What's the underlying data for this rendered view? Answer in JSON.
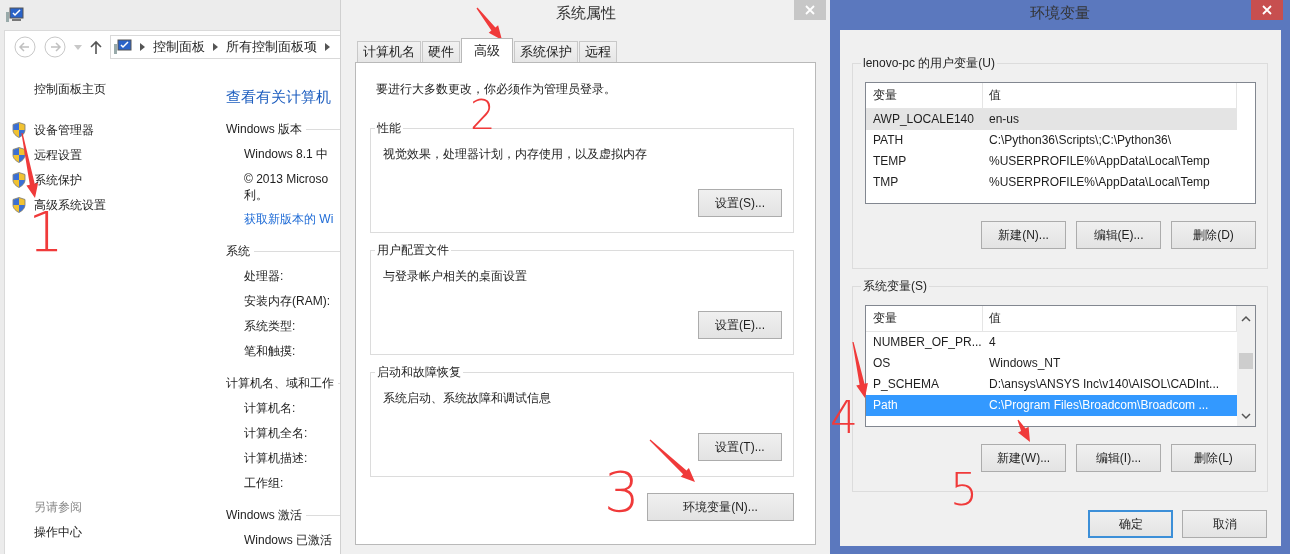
{
  "explorer": {
    "address": [
      "控制面板",
      "所有控制面板项"
    ],
    "nav_home": "控制面板主页",
    "nav_items": [
      "设备管理器",
      "远程设置",
      "系统保护",
      "高级系统设置"
    ],
    "see_also": "另请参阅",
    "see_also_items": [
      "操作中心"
    ],
    "heading": "查看有关计算机",
    "sections": [
      {
        "title": "Windows 版本",
        "items": [
          {
            "kind": "text",
            "text": "Windows 8.1 中"
          },
          {
            "kind": "paragraph",
            "text": "© 2013 Microso\n利。"
          },
          {
            "kind": "link",
            "text": "获取新版本的 Wi"
          }
        ]
      },
      {
        "title": "系统",
        "items": [
          {
            "kind": "text",
            "text": "处理器:"
          },
          {
            "kind": "text",
            "text": "安装内存(RAM):"
          },
          {
            "kind": "text",
            "text": "系统类型:"
          },
          {
            "kind": "text",
            "text": "笔和触摸:"
          }
        ]
      },
      {
        "title": "计算机名、域和工作",
        "items": [
          {
            "kind": "text",
            "text": "计算机名:"
          },
          {
            "kind": "text",
            "text": "计算机全名:"
          },
          {
            "kind": "text",
            "text": "计算机描述:"
          },
          {
            "kind": "text",
            "text": "工作组:"
          }
        ]
      },
      {
        "title": "Windows 激活",
        "items": [
          {
            "kind": "text",
            "text": "Windows 已激活"
          }
        ]
      }
    ]
  },
  "system_properties": {
    "title": "系统属性",
    "tabs": [
      {
        "label": "计算机名",
        "selected": false
      },
      {
        "label": "硬件",
        "selected": false
      },
      {
        "label": "高级",
        "selected": true
      },
      {
        "label": "系统保护",
        "selected": false
      },
      {
        "label": "远程",
        "selected": false
      }
    ],
    "notice": "要进行大多数更改，你必须作为管理员登录。",
    "groups": [
      {
        "title": "性能",
        "description": "视觉效果，处理器计划，内存使用，以及虚拟内存",
        "button": "设置(S)..."
      },
      {
        "title": "用户配置文件",
        "description": "与登录帐户相关的桌面设置",
        "button": "设置(E)..."
      },
      {
        "title": "启动和故障恢复",
        "description": "系统启动、系统故障和调试信息",
        "button": "设置(T)..."
      }
    ],
    "env_button": "环境变量(N)..."
  },
  "env_vars": {
    "title": "环境变量",
    "user_group": {
      "title": "lenovo-pc 的用户变量(U)",
      "focused": false,
      "columns": [
        "变量",
        "值"
      ],
      "rows": [
        {
          "name": "AWP_LOCALE140",
          "value": "en-us",
          "selected": true
        },
        {
          "name": "PATH",
          "value": "C:\\Python36\\Scripts\\;C:\\Python36\\",
          "selected": false
        },
        {
          "name": "TEMP",
          "value": "%USERPROFILE%\\AppData\\Local\\Temp",
          "selected": false
        },
        {
          "name": "TMP",
          "value": "%USERPROFILE%\\AppData\\Local\\Temp",
          "selected": false
        }
      ],
      "buttons": [
        "新建(N)...",
        "编辑(E)...",
        "删除(D)"
      ]
    },
    "system_group": {
      "title": "系统变量(S)",
      "focused": true,
      "columns": [
        "变量",
        "值"
      ],
      "rows": [
        {
          "name": "NUMBER_OF_PR...",
          "value": "4",
          "selected": false
        },
        {
          "name": "OS",
          "value": "Windows_NT",
          "selected": false
        },
        {
          "name": "P_SCHEMA",
          "value": "D:\\ansys\\ANSYS Inc\\v140\\AISOL\\CADInt...",
          "selected": false
        },
        {
          "name": "Path",
          "value": "C:\\Program Files\\Broadcom\\Broadcom ...",
          "selected": true
        }
      ],
      "buttons": [
        "新建(W)...",
        "编辑(I)...",
        "删除(L)"
      ]
    },
    "ok": "确定",
    "cancel": "取消"
  },
  "annotations": [
    {
      "label": "1"
    },
    {
      "label": "2"
    },
    {
      "label": "3"
    },
    {
      "label": "4"
    },
    {
      "label": "5"
    }
  ]
}
